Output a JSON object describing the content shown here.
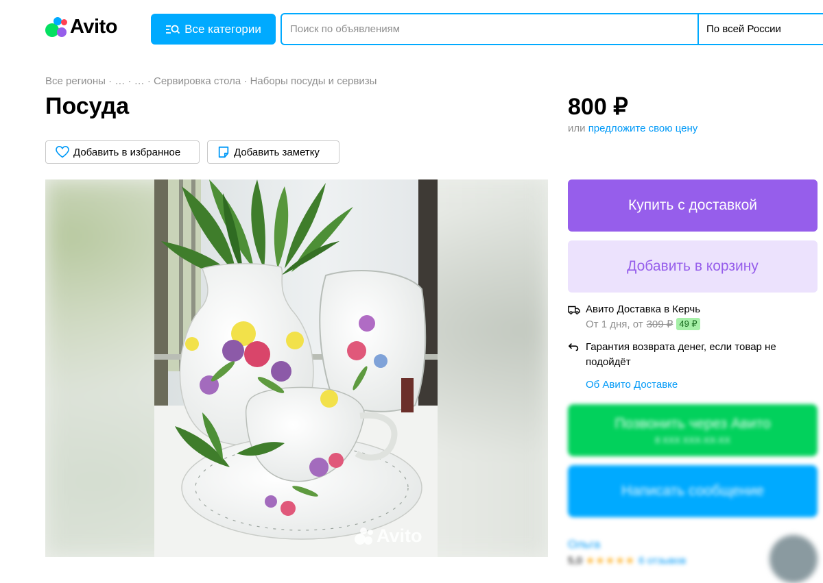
{
  "header": {
    "logo_text": "Avito",
    "categories_label": "Все категории",
    "search_placeholder": "Поиск по объявлениям",
    "region": "По всей России"
  },
  "breadcrumb": [
    "Все регионы",
    "…",
    "…",
    "Сервировка стола",
    "Наборы посуды и сервизы"
  ],
  "breadcrumb_separator": " · ",
  "title": "Посуда",
  "actions": {
    "favorite_label": "Добавить в избранное",
    "note_label": "Добавить заметку"
  },
  "photo": {
    "watermark": "Avito"
  },
  "price": {
    "value": "800 ₽",
    "offer_prefix": "или",
    "offer_link": "предложите свою цену"
  },
  "buttons": {
    "buy": "Купить с доставкой",
    "cart": "Добавить в корзину"
  },
  "delivery": {
    "title": "Авито Доставка в Керчь",
    "time_prefix": "От 1 дня, от",
    "old_price": "309 ₽",
    "new_price": "49 ₽",
    "guarantee": "Гарантия возврата денег, если товар не подойдёт",
    "about_link": "Об Авито Доставке"
  },
  "contact": {
    "call": "Позвонить через Авито",
    "call_sub": "8 XXX XXX-XX-XX",
    "message": "Написать сообщение"
  },
  "seller": {
    "name": "Ольга",
    "rating": "5,0",
    "stars": "★★★★★",
    "reviews": "6 отзывов"
  },
  "colors": {
    "brand_blue": "#00aaff",
    "link_blue": "#0099f7",
    "purple": "#965eeb",
    "purple_light": "#ece2fd",
    "green": "#02d15c"
  }
}
